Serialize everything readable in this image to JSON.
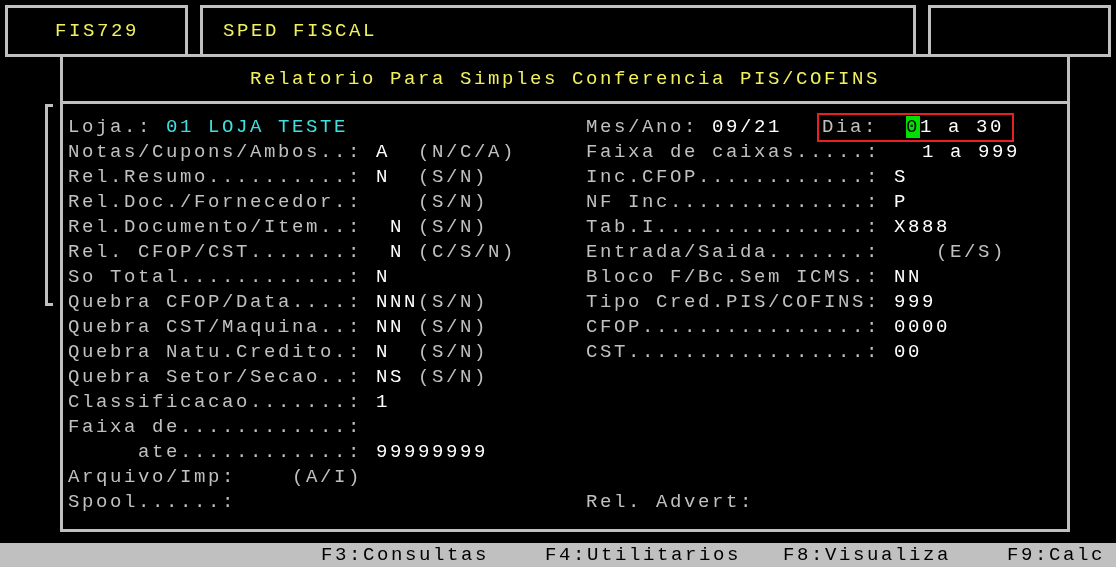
{
  "header": {
    "program_code": "FIS729",
    "module": "SPED FISCAL"
  },
  "dialog": {
    "title": "Relatorio Para Simples Conferencia PIS/COFINS",
    "store": {
      "label": "Loja.:",
      "value": "01 LOJA TESTE"
    },
    "period": {
      "label": "Mes/Ano:",
      "value": "09/21"
    },
    "day_range": {
      "label": "Dia:",
      "value": "01 a 30",
      "focused": true
    },
    "left_fields": [
      {
        "kind": "field",
        "label": "Notas/Cupons/Ambos..:",
        "value": "A",
        "hint": "(N/C/A)"
      },
      {
        "kind": "field",
        "label": "Rel.Resumo..........:",
        "value": "N",
        "hint": "(S/N)"
      },
      {
        "kind": "field",
        "label": "Rel.Doc./Fornecedor.:",
        "hint": "(S/N)"
      },
      {
        "kind": "field",
        "label": "Rel.Documento/Item..:",
        "value": " N",
        "hint": "(S/N)"
      },
      {
        "kind": "field",
        "label": "Rel. CFOP/CST.......:",
        "value": " N",
        "hint": "(C/S/N)"
      },
      {
        "kind": "field",
        "label": "So Total............:",
        "value": "N"
      },
      {
        "kind": "field",
        "label": "Quebra CFOP/Data....:",
        "value": "NNN",
        "hint": "(S/N)"
      },
      {
        "kind": "field",
        "label": "Quebra CST/Maquina..:",
        "value": "NN",
        "hint": "(S/N)"
      },
      {
        "kind": "field",
        "label": "Quebra Natu.Credito.:",
        "value": "N",
        "hint": "(S/N)"
      },
      {
        "kind": "field",
        "label": "Quebra Setor/Secao..:",
        "value": "NS",
        "hint": "(S/N)"
      },
      {
        "kind": "field",
        "label": "Classificacao.......:",
        "value": "1"
      },
      {
        "kind": "field",
        "label": "Faixa de............:"
      },
      {
        "kind": "indented",
        "label": "ate............:",
        "value": "99999999"
      },
      {
        "kind": "short",
        "label": "Arquivo/Imp:",
        "hint": "(A/I)"
      },
      {
        "kind": "short",
        "label": "Spool......:"
      }
    ],
    "right_fields": [
      {
        "kind": "field",
        "label": "Faixa de caixas.....:",
        "value": "  1 a 999"
      },
      {
        "kind": "field",
        "label": "Inc.CFOP............:",
        "value": "S"
      },
      {
        "kind": "field",
        "label": "NF Inc..............:",
        "value": "P"
      },
      {
        "kind": "field",
        "label": "Tab.I...............:",
        "value": "X888"
      },
      {
        "kind": "field",
        "label": "Entrada/Saida.......:",
        "hint": "(E/S)"
      },
      {
        "kind": "field",
        "label": "Bloco F/Bc.Sem ICMS.:",
        "value": "NN"
      },
      {
        "kind": "field",
        "label": "Tipo Cred.PIS/COFINS:",
        "value": "999"
      },
      {
        "kind": "field",
        "label": "CFOP................:",
        "value": "0000"
      },
      {
        "kind": "field",
        "label": "CST.................:",
        "value": "00"
      }
    ],
    "advert": {
      "label": "Rel. Advert:"
    }
  },
  "function_keys": [
    "F3:Consultas",
    "F4:Utilitarios",
    "F8:Visualiza",
    "F9:Calc"
  ]
}
